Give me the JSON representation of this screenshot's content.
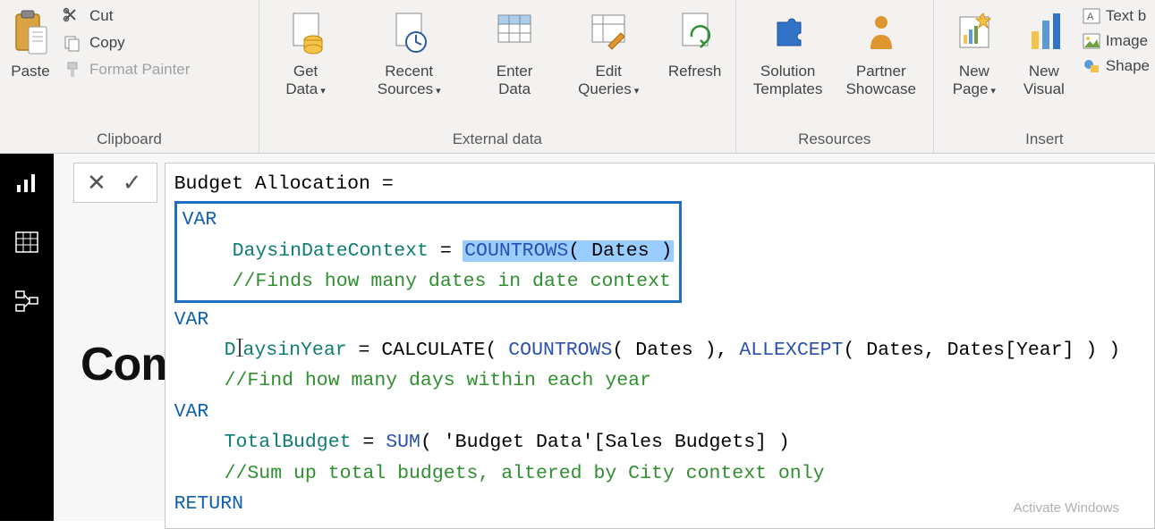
{
  "ribbon": {
    "clipboard": {
      "paste": "Paste",
      "cut": "Cut",
      "copy": "Copy",
      "format_painter": "Format Painter",
      "group_label": "Clipboard"
    },
    "external_data": {
      "get_data": "Get Data",
      "recent_sources": "Recent Sources",
      "enter_data": "Enter Data",
      "edit_queries": "Edit Queries",
      "refresh": "Refresh",
      "group_label": "External data"
    },
    "resources": {
      "solution_templates": "Solution Templates",
      "partner_showcase": "Partner Showcase",
      "group_label": "Resources"
    },
    "insert": {
      "new_page": "New Page",
      "new_visual": "New Visual",
      "text_box": "Text b",
      "image": "Image",
      "shapes": "Shape",
      "group_label": "Insert"
    }
  },
  "formula": {
    "measure_name": "Budget Allocation = ",
    "var": "VAR",
    "return": "RETURN",
    "var1_name": "DaysinDateContext",
    "eq": " = ",
    "var1_func": "COUNTROWS",
    "var1_arg": "( Dates )",
    "var1_comment": "//Finds how many dates in date context",
    "var2_pre": "D",
    "var2_name": "aysinYear",
    "var2_expr_a": " = CALCULATE( ",
    "var2_func_b": "COUNTROWS",
    "var2_expr_c": "( Dates ), ",
    "var2_func_d": "ALLEXCEPT",
    "var2_expr_e": "( Dates, Dates[Year] ) )",
    "var2_comment": "//Find how many days within each year",
    "var3_name": "TotalBudget",
    "var3_expr_a": " = ",
    "var3_func": "SUM",
    "var3_expr_b": "( 'Budget Data'[Sales Budgets] )",
    "var3_comment": "//Sum up total budgets, altered by City context only"
  },
  "canvas": {
    "bg_text": "Com"
  },
  "watermark": "Activate Windows"
}
